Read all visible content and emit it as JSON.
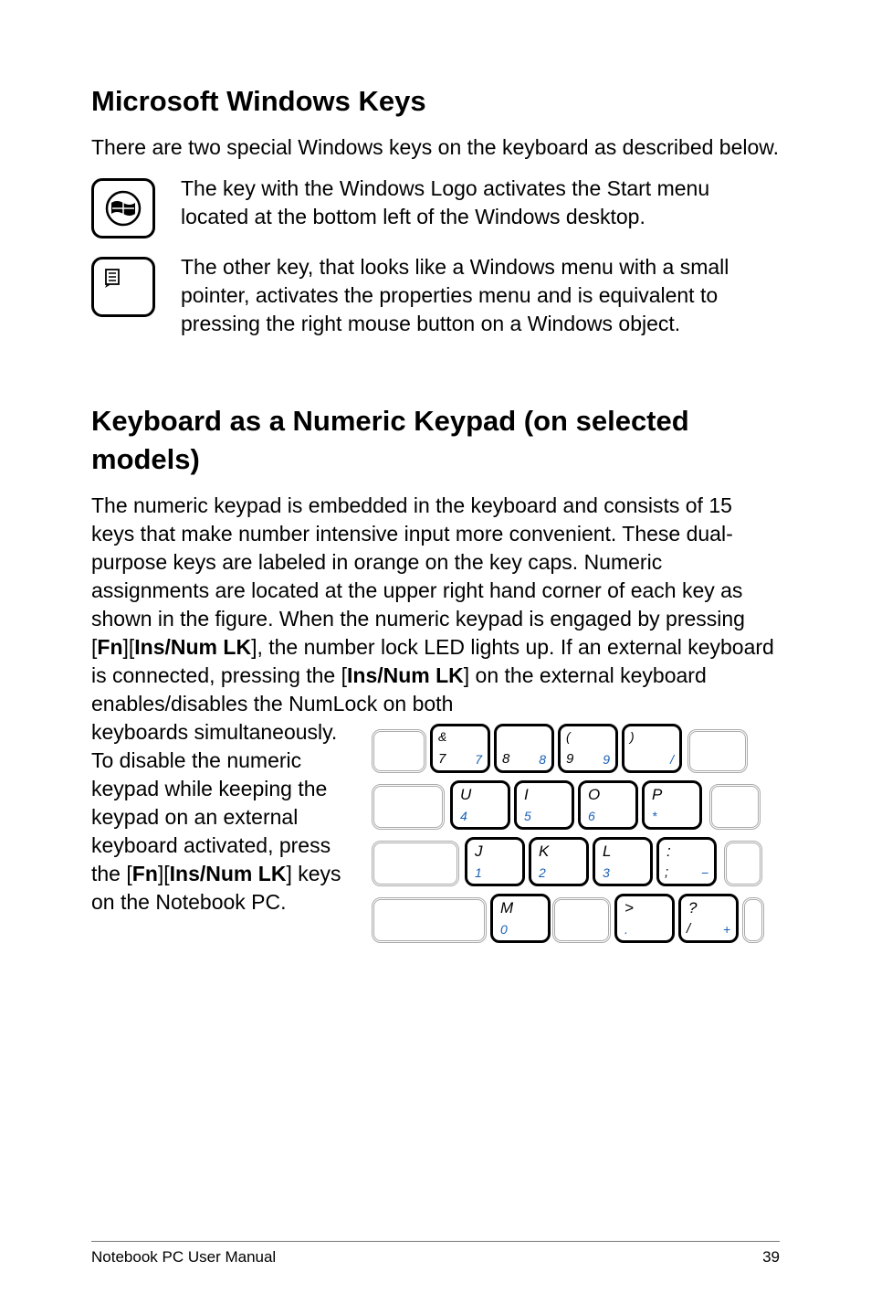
{
  "section1": {
    "heading": "Microsoft Windows Keys",
    "intro": "There are two special Windows keys on the keyboard as described below.",
    "row1": "The key with the Windows Logo activates the Start menu located at the bottom left of the Windows desktop.",
    "row2": "The other key, that looks like a Windows menu with a small pointer, activates the properties menu and is equivalent to pressing the right mouse button on a Windows object."
  },
  "section2": {
    "heading": "Keyboard as a Numeric Keypad (on selected models)",
    "para_a": "The numeric keypad is embedded in the keyboard and consists of 15 keys that make number intensive input more convenient. These dual-purpose keys are labeled in orange on the key caps. Numeric assignments are located at the upper right hand corner of each key as shown in the figure. When the numeric keypad is engaged by pressing [",
    "fn1": "Fn",
    "mid1": "][",
    "ins1": "Ins/Num LK",
    "mid2": "], the number lock LED lights up. If an external keyboard is connected, pressing the [",
    "ins2": "Ins/Num LK",
    "mid3": "] on the external keyboard enables/disables the NumLock on both ",
    "para_b1": "keyboards simultaneously. To disable the numeric keypad while keeping the keypad on an external keyboard activated, press the [",
    "fn2": "Fn",
    "mid4": "][",
    "ins3": "Ins/Num LK",
    "para_b2": "] keys on the Notebook PC."
  },
  "footer": {
    "left": "Notebook PC User Manual",
    "right": "39"
  },
  "keypad": {
    "r1": [
      {
        "tl": "&",
        "bl": "7",
        "br": "7"
      },
      {
        "bl": "8",
        "br": "8"
      },
      {
        "tl": "(",
        "bl": "9",
        "br": "9"
      },
      {
        "tl": ")",
        "br": "/"
      }
    ],
    "r2": [
      {
        "main": "U",
        "sub": "4"
      },
      {
        "main": "I",
        "sub": "5"
      },
      {
        "main": "O",
        "sub": "6"
      },
      {
        "main": "P",
        "sub": "*"
      }
    ],
    "r3": [
      {
        "main": "J",
        "sub": "1"
      },
      {
        "main": "K",
        "sub": "2"
      },
      {
        "main": "L",
        "sub": "3"
      },
      {
        "main": ":",
        "bl": ";",
        "brsmall": "−"
      }
    ],
    "r4": [
      {
        "main": "M",
        "sub": "0"
      },
      {
        "main": ">",
        "sub": "."
      },
      {
        "main": "?",
        "bl": "/",
        "brsmall": "+"
      }
    ]
  }
}
